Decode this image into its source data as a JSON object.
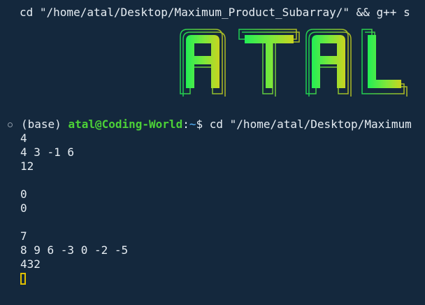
{
  "terminal": {
    "command_top": "cd \"/home/atal/Desktop/Maximum_Product_Subarray/\" && g++ s",
    "prompt": {
      "env": "(base)",
      "user_host": "atal@Coding-World",
      "sep": ":",
      "path": "~",
      "symbol": "$",
      "command": "cd \"/home/atal/Desktop/Maximum"
    },
    "output": [
      "4",
      "4 3 -1 6",
      "12",
      "",
      "0",
      "0",
      "",
      "7",
      "8 9 6 -3 0 -2 -5",
      "432"
    ]
  },
  "banner": {
    "text": "ATAL",
    "colors": [
      "#22ee55",
      "#7ee83a",
      "#c9d420"
    ]
  },
  "colors": {
    "background": "#14283d",
    "text": "#e6edf3",
    "user": "#4cd137",
    "path": "#56b6ff",
    "cursor": "#e0c000"
  }
}
